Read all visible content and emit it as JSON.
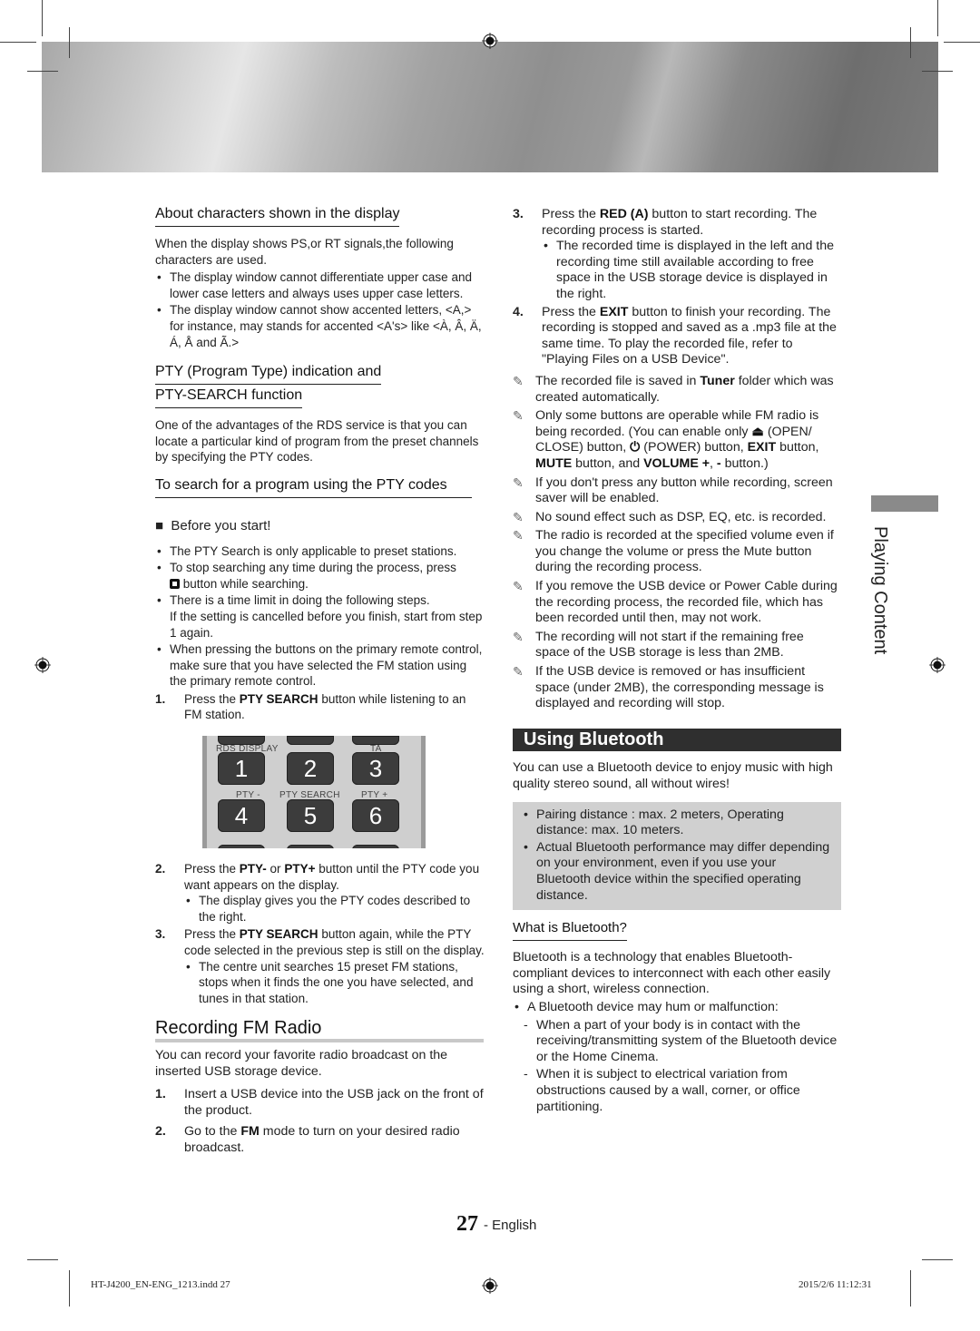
{
  "left": {
    "about_heading": "About characters shown in the display",
    "about_intro": "When the display shows PS,or RT signals,the following characters are used.",
    "about_bullets": [
      "The display window cannot differentiate upper case and lower case letters and always uses upper case letters.",
      "The display window cannot show accented letters, <A,> for instance, may stands for accented <A's> like <À, Â, Ä, Á, Å and Ã.>"
    ],
    "pty_heading_line1": "PTY (Program Type) indication and",
    "pty_heading_line2": "PTY-SEARCH function",
    "pty_intro": "One of the advantages of the RDS service is that you can locate a particular kind of program from the preset channels by specifying the PTY codes.",
    "search_heading": "To search for a program using the PTY codes",
    "before_start": "Before you start!",
    "before_bullets": [
      "The PTY Search is only applicable to preset stations.",
      "button while searching.",
      "There is a time limit in doing the following steps.",
      "If the setting is cancelled before you finish, start from step 1 again.",
      "When pressing the buttons on the primary remote control, make sure that you have selected the FM station using the primary remote control."
    ],
    "stop_bullet_prefix": "To stop searching any time during the process, press",
    "step1": {
      "num": "1.",
      "pre": "Press the ",
      "bold": "PTY SEARCH",
      "post": " button while listening to an FM station."
    },
    "remote": {
      "labels": {
        "rds_display": "RDS DISPLAY",
        "ta": "TA",
        "pty_minus": "PTY -",
        "pty_search": "PTY SEARCH",
        "pty_plus": "PTY +"
      },
      "keys": [
        "1",
        "2",
        "3",
        "4",
        "5",
        "6"
      ]
    },
    "step2": {
      "num": "2.",
      "pre": "Press the ",
      "bold1": "PTY-",
      "mid": " or ",
      "bold2": "PTY+",
      "post": " button until the PTY code you want appears on the display.",
      "sub": "The display gives you the PTY codes described to the right."
    },
    "step3": {
      "num": "3.",
      "pre": "Press the ",
      "bold": "PTY SEARCH",
      "post": " button again, while the PTY code selected in the previous step is still on the display.",
      "sub": "The centre unit searches 15 preset FM stations, stops when it finds the one you have selected, and tunes in that station."
    },
    "recording_heading": "Recording FM Radio",
    "recording_intro": "You can record your favorite radio broadcast on the inserted USB storage device.",
    "rec_step1": {
      "num": "1.",
      "text": "Insert a USB device into the USB jack on the front of the product."
    },
    "rec_step2": {
      "num": "2.",
      "pre": "Go to the ",
      "bold": "FM",
      "post": " mode to turn on your desired radio broadcast."
    }
  },
  "right": {
    "step3": {
      "num": "3.",
      "pre": "Press the ",
      "bold": "RED (A)",
      "post": " button to start recording. The recording process is started.",
      "sub": "The recorded time is displayed in the left and the recording time still available according to free space in the USB storage device is displayed in the right."
    },
    "step4": {
      "num": "4.",
      "pre": "Press the ",
      "bold": "EXIT",
      "post": " button to finish your recording. The recording is stopped and saved as a .mp3 file at the same time. To play the recorded file, refer to \"Playing Files on a USB Device\"."
    },
    "note_icon": "✎",
    "notes": {
      "n1_pre": "The recorded file is saved in ",
      "n1_bold": "Tuner",
      "n1_post": " folder which was created automatically.",
      "n2_a": "Only some buttons are operable while FM radio is being recorded. (You can enable only ",
      "n2_eject": "⏏",
      "n2_b": " (OPEN/ CLOSE) button, ",
      "n2_power": "⏻",
      "n2_c": " (POWER) button, ",
      "n2_exit": "EXIT",
      "n2_d": " button, ",
      "n2_mute": "MUTE",
      "n2_e": " button, and ",
      "n2_volume": "VOLUME +",
      "n2_f": ", ",
      "n2_minus": "-",
      "n2_g": " button.)",
      "n3": "If you don't press any button while recording, screen saver will be enabled.",
      "n4": "No sound effect such as DSP, EQ, etc. is recorded.",
      "n5": "The radio is recorded at the specified volume even if you change the volume or press the Mute button during the recording process.",
      "n6": "If you remove the USB device or Power Cable during the recording process, the recorded file, which has been recorded until then, may not work.",
      "n7": "The recording will not start if the remaining free space of the USB storage is less than 2MB.",
      "n8": "If the USB device is removed or has insufficient space (under 2MB), the corresponding message is displayed and recording will stop."
    },
    "bt_heading": "Using Bluetooth",
    "bt_intro": "You can use a Bluetooth device to enjoy music with high quality stereo sound, all without wires!",
    "bt_box": [
      "Pairing distance : max. 2 meters, Operating distance: max. 10 meters.",
      "Actual Bluetooth performance may differ depending on your environment, even if you use your Bluetooth device within the specified operating distance."
    ],
    "what_heading": "What is Bluetooth?",
    "what_intro": "Bluetooth is a technology that enables Bluetooth-compliant devices to interconnect with each other easily using a short, wireless connection.",
    "what_bullet": "A Bluetooth device may hum or malfunction:",
    "what_dashes": [
      "When a part of your body is in contact with the receiving/transmitting system of the Bluetooth device or the Home Cinema.",
      "When it is subject to electrical variation from obstructions caused by a wall, corner, or office partitioning."
    ]
  },
  "side_tab": "Playing Content",
  "page": {
    "number": "27",
    "language": "- English"
  },
  "footer": {
    "file": "HT-J4200_EN-ENG_1213.indd   27",
    "timestamp": "2015/2/6   11:12:31"
  }
}
